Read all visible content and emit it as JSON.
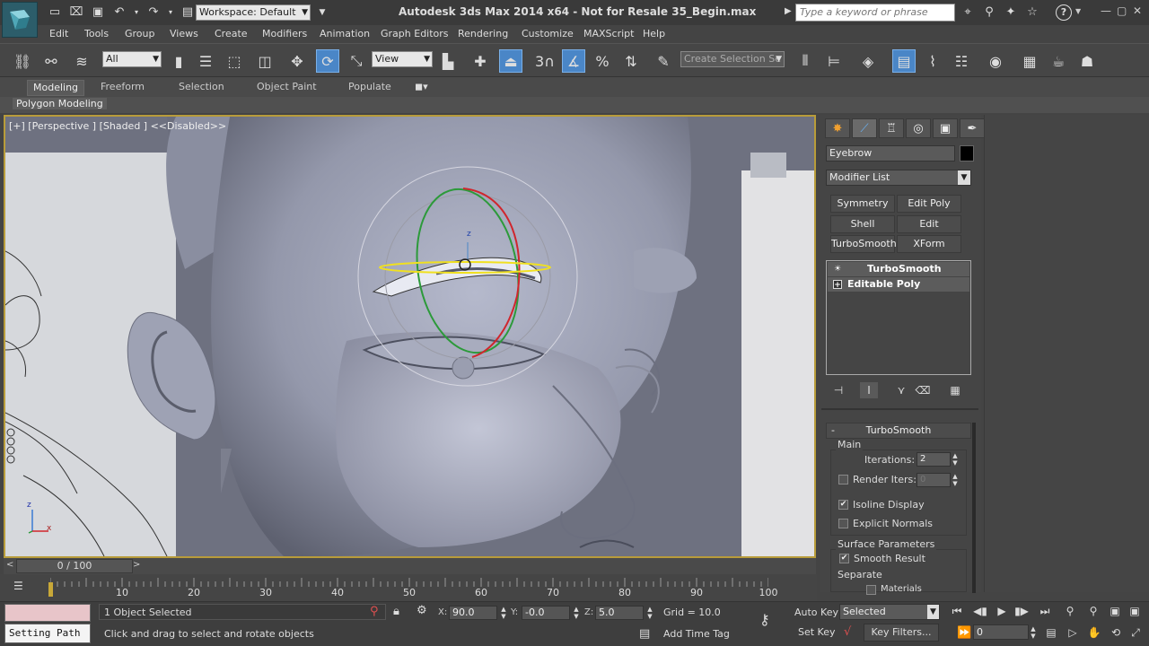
{
  "titlebar": {
    "workspace_label": "Workspace: Default",
    "title": "Autodesk 3ds Max  2014 x64  - Not for Resale   35_Begin.max",
    "search_placeholder": "Type a keyword or phrase",
    "help_label": "?"
  },
  "menu": [
    "Edit",
    "Tools",
    "Group",
    "Views",
    "Create",
    "Modifiers",
    "Animation",
    "Graph Editors",
    "Rendering",
    "Customize",
    "MAXScript",
    "Help"
  ],
  "toolbar": {
    "selection_filter": "All",
    "ref_coord": "View",
    "snap_label": "3",
    "named_selection_placeholder": "Create Selection Se"
  },
  "ribbon": {
    "tabs": [
      "Modeling",
      "Freeform",
      "Selection",
      "Object Paint",
      "Populate"
    ],
    "active_tab": "Modeling",
    "sub_panel": "Polygon Modeling"
  },
  "viewport": {
    "label": "[+] [Perspective ] [Shaded ]  <<Disabled>>",
    "axis_z": "z",
    "axis_x": "x",
    "gizmo_z": "z"
  },
  "command_panel": {
    "object_name": "Eyebrow",
    "modifier_list": "Modifier List",
    "modifier_buttons": [
      "Symmetry",
      "Edit Poly",
      "Shell",
      "Edit Normals",
      "TurboSmooth",
      "XForm"
    ],
    "stack": [
      {
        "label": "TurboSmooth",
        "icon": "bulb-icon"
      },
      {
        "label": "Editable Poly",
        "icon": "plus-icon"
      }
    ],
    "rollout": {
      "title": "TurboSmooth",
      "collapse": "-",
      "main_group": "Main",
      "iterations_label": "Iterations:",
      "iterations_value": "2",
      "render_iters_label": "Render Iters:",
      "render_iters_value": "0",
      "render_iters_checked": false,
      "isoline_label": "Isoline Display",
      "isoline_checked": true,
      "explicit_normals_label": "Explicit Normals",
      "explicit_normals_checked": false,
      "surface_group": "Surface Parameters",
      "smooth_result_label": "Smooth Result",
      "smooth_result_checked": true,
      "separate_label": "Separate",
      "materials_label": "Materials"
    }
  },
  "timeline": {
    "frame_readout": "0 / 100",
    "prev_arrow": "<",
    "next_arrow": ">",
    "ticks": [
      "10",
      "20",
      "30",
      "40",
      "50",
      "60",
      "70",
      "80",
      "90",
      "100"
    ],
    "current_frame": 0,
    "frame_max": 100
  },
  "status": {
    "maxscript_label": "Setting Path",
    "selection": "1 Object Selected",
    "prompt": "Click and drag to select and rotate objects",
    "x_label": "X:",
    "x_value": "90.0",
    "y_label": "Y:",
    "y_value": "-0.0",
    "z_label": "Z:",
    "z_value": "5.0",
    "grid": "Grid = 10.0",
    "add_time_tag": "Add Time Tag",
    "auto_key": "Auto Key",
    "set_key": "Set Key",
    "key_mode": "Selected",
    "key_filters": "Key Filters...",
    "frame_value": "0"
  },
  "colors": {
    "viewport_border": "#b89c3a",
    "active_blue": "#4a86c7",
    "gizmo_red": "#d0262d",
    "gizmo_green": "#2c9a3a",
    "gizmo_yellow": "#f0e020"
  }
}
